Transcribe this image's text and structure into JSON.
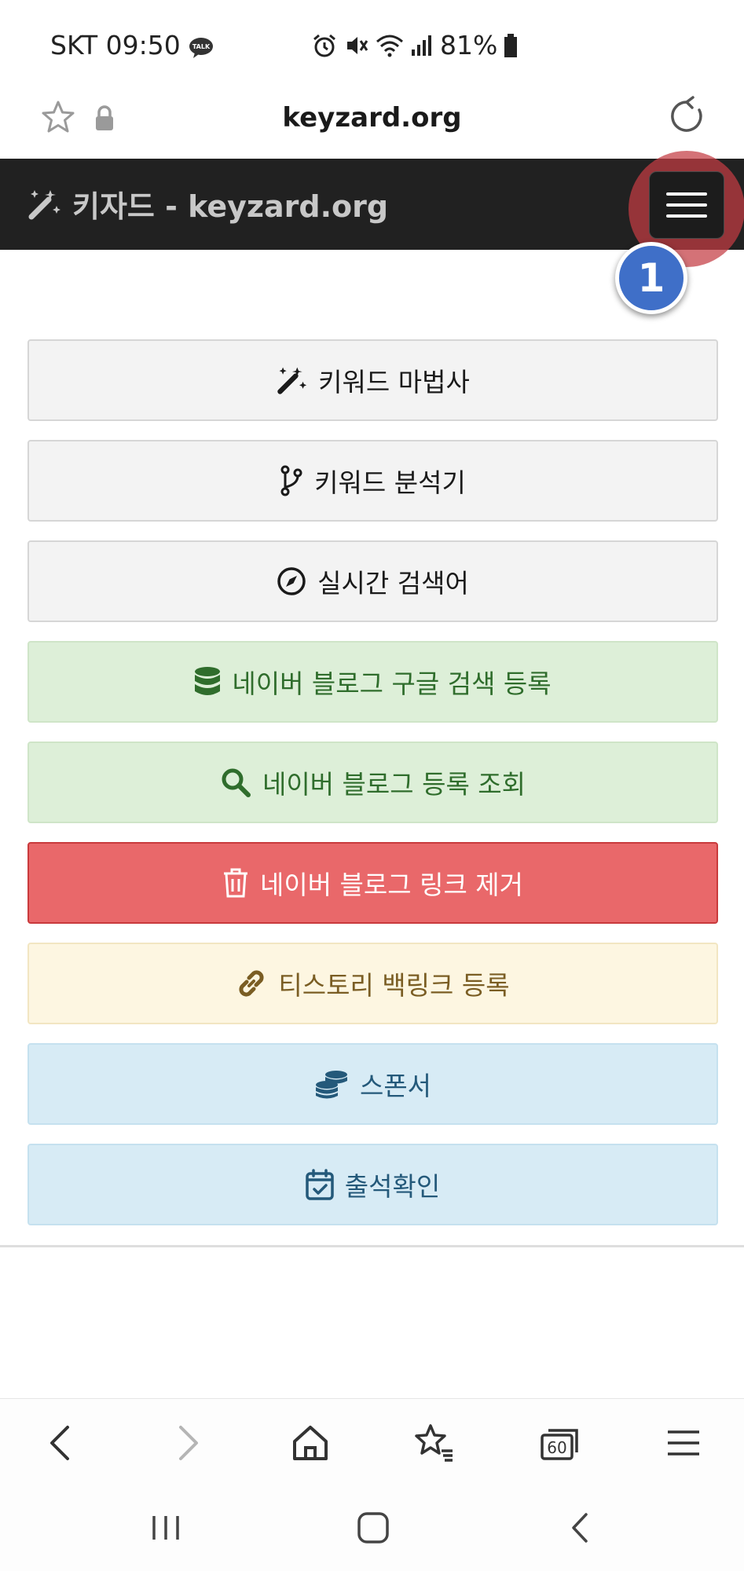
{
  "status_bar": {
    "carrier_time": "SKT 09:50",
    "talk_badge": "TALK",
    "battery": "81%"
  },
  "address_bar": {
    "url": "keyzard.org"
  },
  "navbar": {
    "brand": "키자드 - keyzard.org"
  },
  "annotation": {
    "step": "1",
    "highlight_color": "#c43c42",
    "badge_color": "#3f6fc8"
  },
  "menu": [
    {
      "label": "키워드 마법사",
      "icon": "magic-wand-icon",
      "style": "light"
    },
    {
      "label": "키워드 분석기",
      "icon": "code-branch-icon",
      "style": "light"
    },
    {
      "label": "실시간 검색어",
      "icon": "compass-icon",
      "style": "light"
    },
    {
      "label": "네이버 블로그 구글 검색 등록",
      "icon": "database-icon",
      "style": "success"
    },
    {
      "label": "네이버 블로그 등록 조회",
      "icon": "search-icon",
      "style": "success"
    },
    {
      "label": "네이버 블로그 링크 제거",
      "icon": "trash-icon",
      "style": "danger"
    },
    {
      "label": "티스토리 백링크 등록",
      "icon": "link-icon",
      "style": "warning"
    },
    {
      "label": "스폰서",
      "icon": "coins-icon",
      "style": "info"
    },
    {
      "label": "출석확인",
      "icon": "calendar-check-icon",
      "style": "info"
    }
  ],
  "browser_bar": {
    "tab_count": "60"
  }
}
